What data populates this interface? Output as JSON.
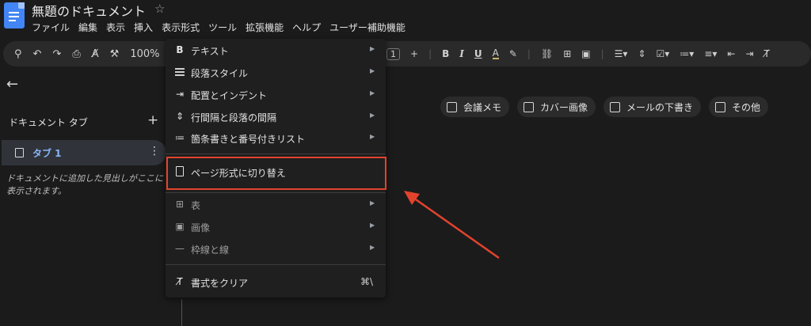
{
  "app": {
    "title": "無題のドキュメント",
    "star": "☆"
  },
  "menubar": [
    "ファイル",
    "編集",
    "表示",
    "挿入",
    "表示形式",
    "ツール",
    "拡張機能",
    "ヘルプ",
    "ユーザー補助機能"
  ],
  "toolbar": {
    "left_icons": [
      "search-icon",
      "undo-icon",
      "redo-icon",
      "print-icon",
      "spellcheck-icon",
      "paint-format-icon"
    ],
    "zoom": "100%",
    "font_size": "1",
    "plus": "+",
    "bold": "B",
    "italic": "I",
    "underline": "U",
    "text_color": "A",
    "right_icons": [
      "highlight-icon",
      "link-icon",
      "comment-icon",
      "image-icon",
      "align-icon",
      "line-spacing-icon",
      "checklist-icon",
      "bullet-list-icon",
      "numbered-list-icon",
      "decrease-indent-icon",
      "clear-format-icon"
    ]
  },
  "sidebar": {
    "back": "←",
    "tabs_title": "ドキュメント タブ",
    "add": "+",
    "tab_label": "タブ 1",
    "more": "⋮",
    "hint": "ドキュメントに追加した見出しがここに表示されます。"
  },
  "chips": [
    {
      "label": "会議メモ",
      "icon": "document-icon"
    },
    {
      "label": "カバー画像",
      "icon": "image-icon"
    },
    {
      "label": "メールの下書き",
      "icon": "mail-icon"
    },
    {
      "label": "その他",
      "icon": "more-icon"
    }
  ],
  "menu": {
    "items": [
      {
        "label": "テキスト",
        "icon": "B",
        "submenu": true
      },
      {
        "label": "段落スタイル",
        "icon": "paragraph-style-icon",
        "submenu": true
      },
      {
        "label": "配置とインデント",
        "icon": "align-indent-icon",
        "submenu": true
      },
      {
        "label": "行間隔と段落の間隔",
        "icon": "line-spacing-icon",
        "submenu": true
      },
      {
        "label": "箇条書きと番号付きリスト",
        "icon": "list-icon",
        "submenu": true
      },
      {
        "label": "ページ形式に切り替え",
        "icon": "page-icon",
        "submenu": false
      },
      {
        "label": "表",
        "icon": "table-icon",
        "submenu": true
      },
      {
        "label": "画像",
        "icon": "image-icon",
        "submenu": true
      },
      {
        "label": "枠線と線",
        "icon": "border-icon",
        "submenu": true
      },
      {
        "label": "書式をクリア",
        "icon": "clear-format-icon",
        "shortcut": "⌘\\"
      }
    ]
  },
  "colors": {
    "highlight_box": "#e2432d",
    "arrow": "#e2432d",
    "tab_label": "#8ab4f8"
  }
}
